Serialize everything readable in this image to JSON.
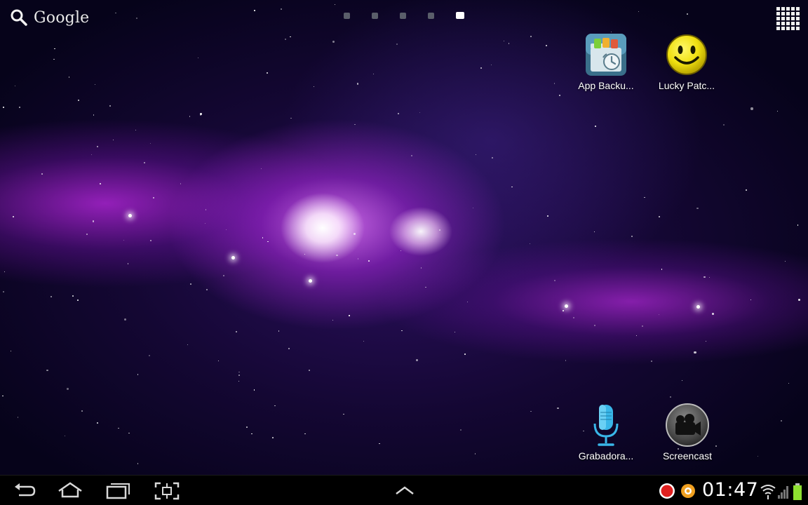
{
  "search": {
    "label": "Google",
    "icon": "search-icon"
  },
  "pages": {
    "count": 5,
    "active_index": 4
  },
  "apps_button": {
    "icon": "apps-grid-icon"
  },
  "shortcuts": [
    {
      "label": "App Backu...",
      "icon": "app-backup-icon"
    },
    {
      "label": "Lucky Patc...",
      "icon": "smiley-icon"
    },
    {
      "label": "Grabadora...",
      "icon": "microphone-icon"
    },
    {
      "label": "Screencast",
      "icon": "video-camera-icon"
    }
  ],
  "navbar": {
    "back_icon": "back-icon",
    "home_icon": "home-icon",
    "recents_icon": "recent-apps-icon",
    "screenshot_icon": "screenshot-icon",
    "up_icon": "chevron-up-icon"
  },
  "status": {
    "time": "01:47",
    "icons": [
      "record-icon",
      "notification-icon",
      "wifi-icon",
      "signal-icon",
      "battery-icon"
    ],
    "accent_record": "#e0201f",
    "accent_notification": "#f0a020",
    "accent_battery": "#8ee030"
  }
}
